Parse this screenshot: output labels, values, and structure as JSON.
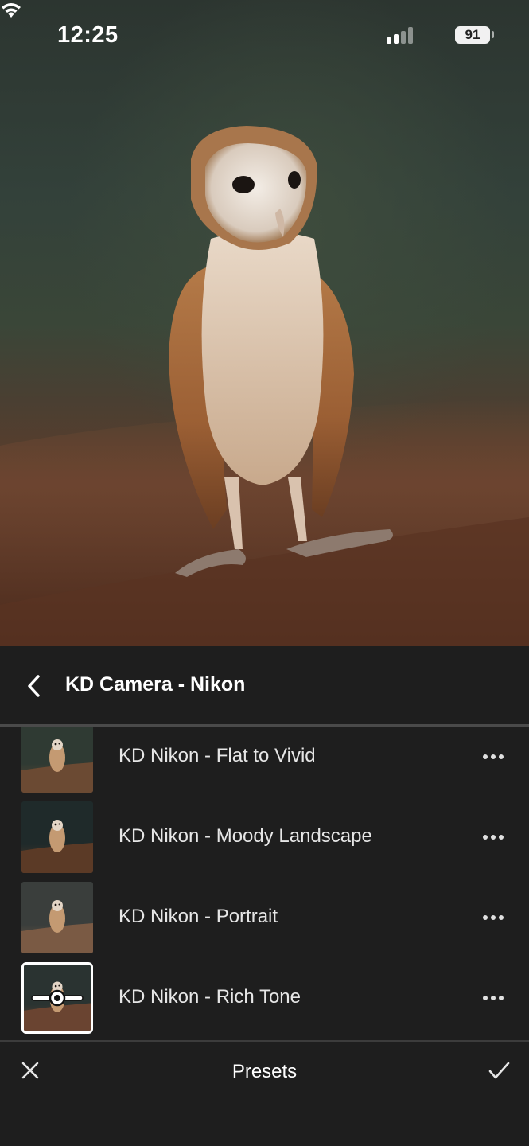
{
  "status_bar": {
    "time": "12:25",
    "battery_level": "91",
    "signal_icon": "cellular-signal-icon",
    "wifi_icon": "wifi-icon"
  },
  "photo": {
    "subject": "barn-owl-photo"
  },
  "header": {
    "back_icon": "chevron-left-icon",
    "title": "KD Camera - Nikon"
  },
  "presets": [
    {
      "label": "KD Nikon - Flat to Vivid",
      "selected": false,
      "more_icon": "ellipsis-icon"
    },
    {
      "label": "KD Nikon - Moody Landscape",
      "selected": false,
      "more_icon": "ellipsis-icon"
    },
    {
      "label": "KD Nikon - Portrait",
      "selected": false,
      "more_icon": "ellipsis-icon"
    },
    {
      "label": "KD Nikon - Rich Tone",
      "selected": true,
      "more_icon": "ellipsis-icon"
    }
  ],
  "bottom_bar": {
    "close_icon": "close-icon",
    "title": "Presets",
    "done_icon": "checkmark-icon"
  },
  "colors": {
    "panel_background": "#1e1e1e",
    "text_primary": "#ffffff",
    "text_secondary": "#e6e6e6",
    "divider": "#4a4a4a"
  }
}
